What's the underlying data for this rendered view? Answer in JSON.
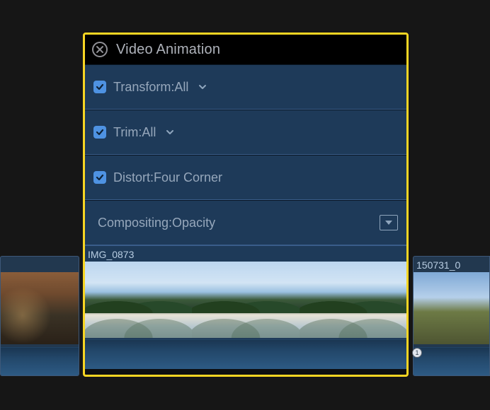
{
  "panel": {
    "title": "Video Animation",
    "rows": {
      "transform": {
        "label": "Transform:All",
        "checked": true,
        "hasChevron": true
      },
      "trim": {
        "label": "Trim:All",
        "checked": true,
        "hasChevron": true
      },
      "distort": {
        "label": "Distort:Four Corner",
        "checked": true,
        "hasChevron": false
      },
      "compositing": {
        "label": "Compositing:Opacity"
      }
    },
    "clipTitle": "IMG_0873"
  },
  "timeline": {
    "leftClipTitle": "",
    "rightClipTitle": "150731_0",
    "anchorLabel": "1"
  }
}
